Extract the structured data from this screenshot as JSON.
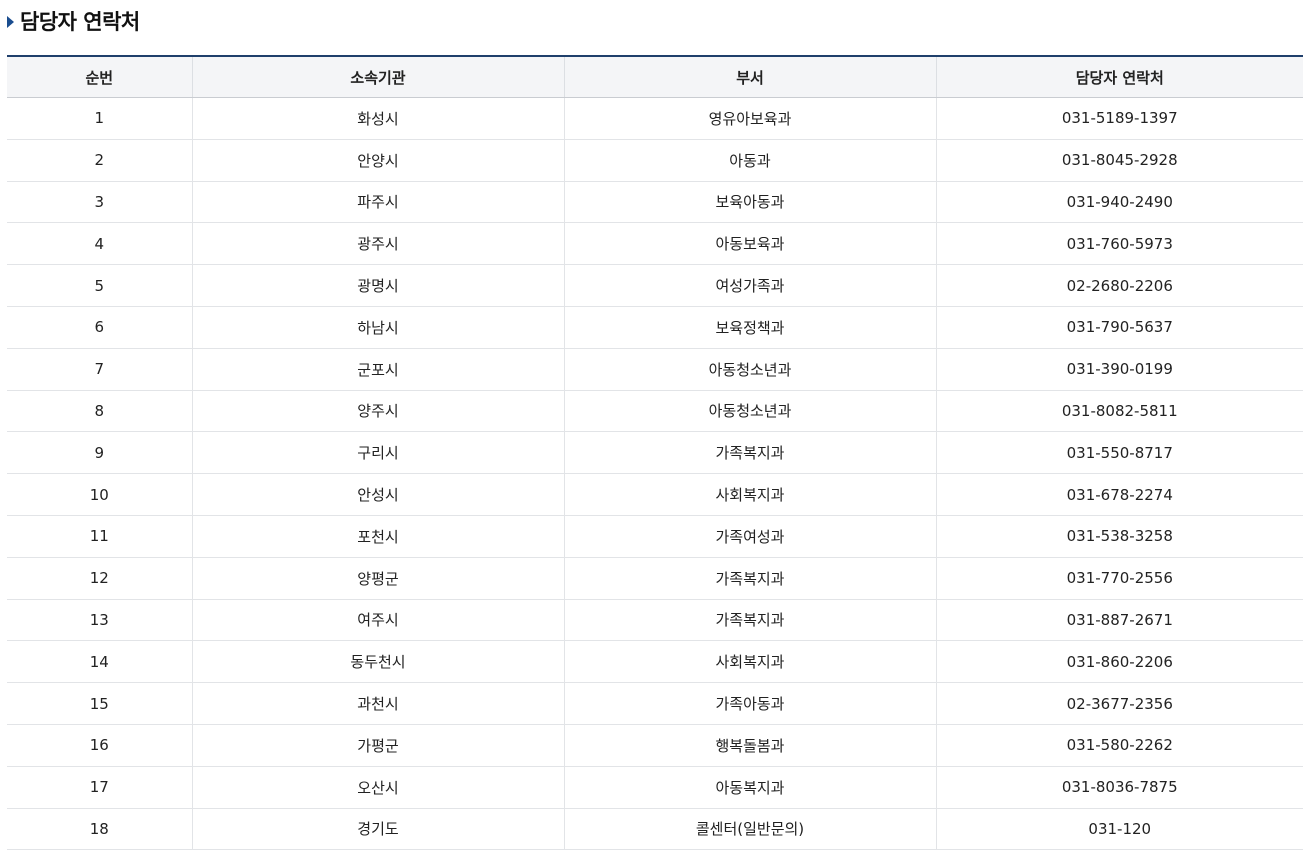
{
  "page": {
    "title": "담당자 연락처"
  },
  "table": {
    "headers": {
      "no": "순번",
      "org": "소속기관",
      "dept": "부서",
      "phone": "담당자 연락처"
    },
    "rows": [
      {
        "no": "1",
        "org": "화성시",
        "dept": "영유아보육과",
        "phone": "031-5189-1397"
      },
      {
        "no": "2",
        "org": "안양시",
        "dept": "아동과",
        "phone": "031-8045-2928"
      },
      {
        "no": "3",
        "org": "파주시",
        "dept": "보육아동과",
        "phone": "031-940-2490"
      },
      {
        "no": "4",
        "org": "광주시",
        "dept": "아동보육과",
        "phone": "031-760-5973"
      },
      {
        "no": "5",
        "org": "광명시",
        "dept": "여성가족과",
        "phone": "02-2680-2206"
      },
      {
        "no": "6",
        "org": "하남시",
        "dept": "보육정책과",
        "phone": "031-790-5637"
      },
      {
        "no": "7",
        "org": "군포시",
        "dept": "아동청소년과",
        "phone": "031-390-0199"
      },
      {
        "no": "8",
        "org": "양주시",
        "dept": "아동청소년과",
        "phone": "031-8082-5811"
      },
      {
        "no": "9",
        "org": "구리시",
        "dept": "가족복지과",
        "phone": "031-550-8717"
      },
      {
        "no": "10",
        "org": "안성시",
        "dept": "사회복지과",
        "phone": "031-678-2274"
      },
      {
        "no": "11",
        "org": "포천시",
        "dept": "가족여성과",
        "phone": "031-538-3258"
      },
      {
        "no": "12",
        "org": "양평군",
        "dept": "가족복지과",
        "phone": "031-770-2556"
      },
      {
        "no": "13",
        "org": "여주시",
        "dept": "가족복지과",
        "phone": "031-887-2671"
      },
      {
        "no": "14",
        "org": "동두천시",
        "dept": "사회복지과",
        "phone": "031-860-2206"
      },
      {
        "no": "15",
        "org": "과천시",
        "dept": "가족아동과",
        "phone": "02-3677-2356"
      },
      {
        "no": "16",
        "org": "가평군",
        "dept": "행복돌봄과",
        "phone": "031-580-2262"
      },
      {
        "no": "17",
        "org": "오산시",
        "dept": "아동복지과",
        "phone": "031-8036-7875"
      },
      {
        "no": "18",
        "org": "경기도",
        "dept": "콜센터(일반문의)",
        "phone": "031-120"
      }
    ]
  },
  "colors": {
    "accent": "#1a4d8f",
    "table_top_border": "#1f3f6b",
    "header_bg": "#f4f5f7"
  }
}
